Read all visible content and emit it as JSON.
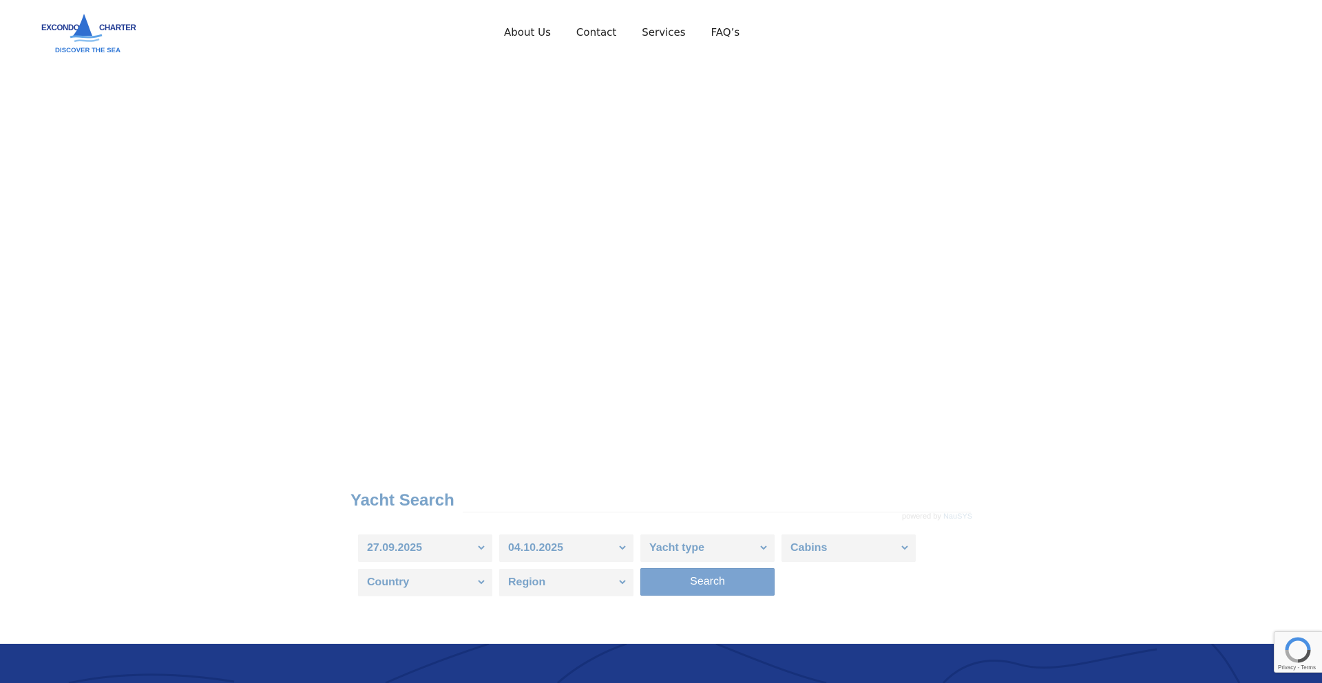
{
  "header": {
    "logo": {
      "left_word": "EXCONDO",
      "right_word": "CHARTER",
      "tagline": "DISCOVER THE SEA"
    },
    "nav": [
      {
        "label": "About Us"
      },
      {
        "label": "Contact"
      },
      {
        "label": "Services"
      },
      {
        "label": "FAQ’s"
      }
    ]
  },
  "yacht_search": {
    "title": "Yacht Search",
    "powered_by": "powered by",
    "powered_brand": "NauSYS",
    "date_from": "27.09.2025",
    "date_to": "04.10.2025",
    "yacht_type": "Yacht type",
    "cabins": "Cabins",
    "country": "Country",
    "region": "Region",
    "search_label": "Search"
  },
  "recaptcha": {
    "terms": "Privacy - Terms"
  },
  "colors": {
    "brand_navy": "#1e3a8a",
    "field_text": "#7aa3c9",
    "search_button": "#7ba3d0"
  }
}
